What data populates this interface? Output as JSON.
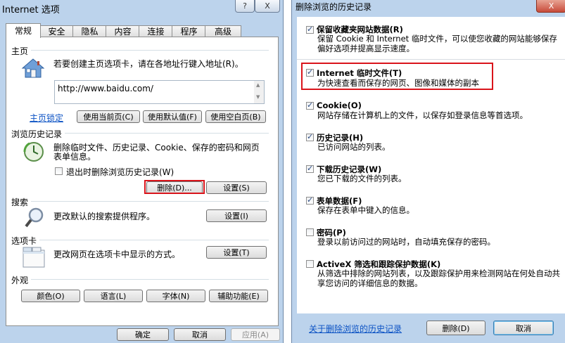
{
  "left_dialog": {
    "title": "Internet 选项",
    "help_label": "?",
    "close_label": "X",
    "tabs": [
      "常规",
      "安全",
      "隐私",
      "内容",
      "连接",
      "程序",
      "高级"
    ],
    "home": {
      "group_title": "主页",
      "description": "若要创建主页选项卡，请在各地址行键入地址(R)。",
      "url": "http://www.baidu.com/",
      "lock_link": "主页锁定",
      "use_current": "使用当前页(C)",
      "use_default": "使用默认值(F)",
      "use_blank": "使用空白页(B)"
    },
    "history": {
      "group_title": "浏览历史记录",
      "description_line1": "删除临时文件、历史记录、Cookie、保存的密码和网页",
      "description_line2": "表单信息。",
      "delete_on_exit": "退出时删除浏览历史记录(W)",
      "delete_button": "删除(D)...",
      "settings_button": "设置(S)"
    },
    "search": {
      "group_title": "搜索",
      "description": "更改默认的搜索提供程序。",
      "settings_button": "设置(I)"
    },
    "tabs_group": {
      "group_title": "选项卡",
      "description": "更改网页在选项卡中显示的方式。",
      "settings_button": "设置(T)"
    },
    "appearance": {
      "group_title": "外观",
      "colors": "颜色(O)",
      "languages": "语言(L)",
      "fonts": "字体(N)",
      "accessibility": "辅助功能(E)"
    },
    "footer": {
      "ok": "确定",
      "cancel": "取消",
      "apply": "应用(A)"
    }
  },
  "right_dialog": {
    "title": "删除浏览的历史记录",
    "close_label": "X",
    "options": [
      {
        "title": "保留收藏夹网站数据(R)",
        "desc": "保留 Cookie 和 Internet 临时文件，可以使您收藏的网站能够保存偏好选项并提高显示速度。",
        "checked": true
      },
      {
        "title": "Internet 临时文件(T)",
        "desc": "为快速查看而保存的网页、图像和媒体的副本",
        "checked": true
      },
      {
        "title": "Cookie(O)",
        "desc": "网站存储在计算机上的文件，以保存如登录信息等首选项。",
        "checked": true
      },
      {
        "title": "历史记录(H)",
        "desc": "已访问网站的列表。",
        "checked": true
      },
      {
        "title": "下载历史记录(W)",
        "desc": "您已下载的文件的列表。",
        "checked": true
      },
      {
        "title": "表单数据(F)",
        "desc": "保存在表单中键入的信息。",
        "checked": true
      },
      {
        "title": "密码(P)",
        "desc": "登录以前访问过的网站时，自动填充保存的密码。",
        "checked": false
      },
      {
        "title": "ActiveX 筛选和跟踪保护数据(K)",
        "desc": "从筛选中排除的网站列表，以及跟踪保护用来检测网站在何处自动共享您访问的详细信息的数据。",
        "checked": false
      }
    ],
    "about_link": "关于删除浏览的历史记录",
    "delete_button": "删除(D)",
    "cancel_button": "取消"
  }
}
